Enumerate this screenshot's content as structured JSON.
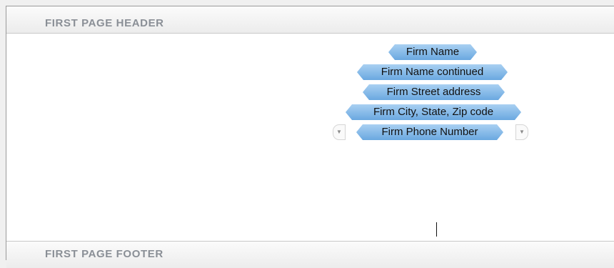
{
  "header": {
    "label": "FIRST PAGE HEADER"
  },
  "footer": {
    "label": "FIRST PAGE FOOTER"
  },
  "fields": [
    {
      "label": "Firm Name"
    },
    {
      "label": "Firm Name continued"
    },
    {
      "label": "Firm Street address"
    },
    {
      "label": "Firm City, State, Zip code"
    },
    {
      "label": "Firm Phone Number"
    }
  ],
  "icons": {
    "left_dropdown": "chevron-down-icon",
    "right_dropdown": "chevron-down-icon"
  },
  "colors": {
    "chip_top": "#a9d0f2",
    "chip_bottom": "#6aa8e0",
    "section_label": "#8a8f96"
  }
}
